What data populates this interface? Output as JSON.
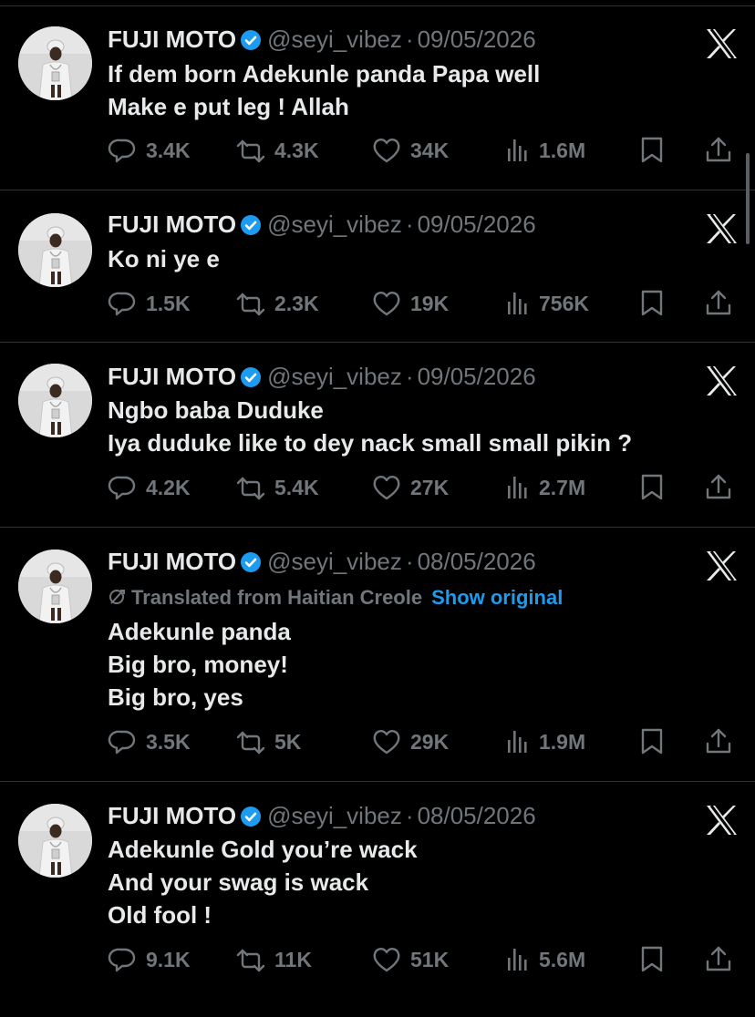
{
  "colors": {
    "background": "#000000",
    "text": "#e7e9ea",
    "muted": "#71767b",
    "accent": "#1d9bf0",
    "divider": "#2f3336"
  },
  "tweets": [
    {
      "author_name": "FUJI MOTO",
      "handle": "@seyi_vibez",
      "separator": "·",
      "date": "09/05/2026",
      "lines": [
        "If dem born Adekunle panda Papa well",
        "Make e put leg ! Allah"
      ],
      "replies": "3.4K",
      "retweets": "4.3K",
      "likes": "34K",
      "views": "1.6M"
    },
    {
      "author_name": "FUJI MOTO",
      "handle": "@seyi_vibez",
      "separator": "·",
      "date": "09/05/2026",
      "lines": [
        "Ko ni ye e"
      ],
      "replies": "1.5K",
      "retweets": "2.3K",
      "likes": "19K",
      "views": "756K"
    },
    {
      "author_name": "FUJI MOTO",
      "handle": "@seyi_vibez",
      "separator": "·",
      "date": "09/05/2026",
      "lines": [
        "Ngbo baba Duduke",
        "Iya duduke like to dey nack small small pikin ?"
      ],
      "replies": "4.2K",
      "retweets": "5.4K",
      "likes": "27K",
      "views": "2.7M"
    },
    {
      "author_name": "FUJI MOTO",
      "handle": "@seyi_vibez",
      "separator": "·",
      "date": "08/05/2026",
      "translated_label": "Translated from Haitian Creole",
      "show_original": "Show original",
      "lines": [
        "Adekunle panda",
        "Big bro, money!",
        "Big bro, yes"
      ],
      "replies": "3.5K",
      "retweets": "5K",
      "likes": "29K",
      "views": "1.9M"
    },
    {
      "author_name": "FUJI MOTO",
      "handle": "@seyi_vibez",
      "separator": "·",
      "date": "08/05/2026",
      "lines": [
        "Adekunle Gold you’re wack",
        "And your swag is wack",
        "Old fool !"
      ],
      "replies": "9.1K",
      "retweets": "11K",
      "likes": "51K",
      "views": "5.6M"
    }
  ]
}
